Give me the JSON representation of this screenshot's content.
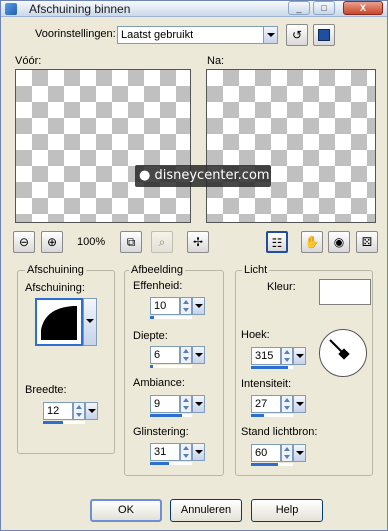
{
  "window": {
    "title": "Afschuining binnen",
    "controls": [
      "_",
      "□",
      "X"
    ]
  },
  "presets": {
    "label": "Voorinstellingen:",
    "value": "Laatst gebruikt"
  },
  "preview": {
    "before_label": "Vóór:",
    "after_label": "Na:",
    "watermark": "● disneycenter.com"
  },
  "toolbar": {
    "zoom": "100%"
  },
  "bevel": {
    "group_label": "Afschuining",
    "shape_label": "Afschuining:",
    "width_label": "Breedte:",
    "width_value": "12"
  },
  "image": {
    "group_label": "Afbeelding",
    "smoothness": {
      "label": "Effenheid:",
      "value": "10",
      "level": 0.1
    },
    "depth": {
      "label": "Diepte:",
      "value": "6",
      "level": 0.06
    },
    "ambience": {
      "label": "Ambiance:",
      "value": "9",
      "level": 0.75
    },
    "shininess": {
      "label": "Glinstering:",
      "value": "31",
      "level": 0.45
    }
  },
  "light": {
    "group_label": "Licht",
    "color_label": "Kleur:",
    "color": "#ffffff",
    "angle": {
      "label": "Hoek:",
      "value": "315",
      "level": 0.88
    },
    "intensity": {
      "label": "Intensiteit:",
      "value": "27",
      "level": 0.3
    },
    "elevation": {
      "label": "Stand lichtbron:",
      "value": "60",
      "level": 0.65
    }
  },
  "buttons": {
    "ok": "OK",
    "cancel": "Annuleren",
    "help": "Help"
  }
}
